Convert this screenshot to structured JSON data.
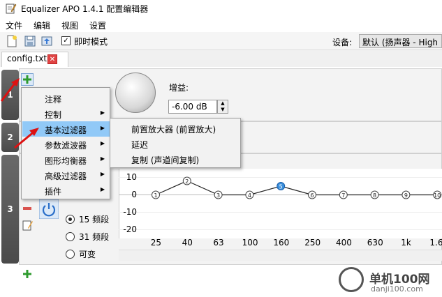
{
  "window": {
    "title": "Equalizer APO 1.4.1 配置编辑器"
  },
  "menubar": {
    "items": [
      "文件",
      "编辑",
      "视图",
      "设置"
    ]
  },
  "toolbar": {
    "instant_mode_label": "即时模式",
    "instant_mode_checked": true,
    "device_label": "设备:",
    "device_value": "默认 (扬声器 - High De"
  },
  "tabs": [
    {
      "label": "config.txt",
      "close_icon": "close-icon"
    }
  ],
  "sections": [
    "1",
    "2",
    "3"
  ],
  "preamp": {
    "gain_label": "增益:",
    "gain_value": "-6.00 dB"
  },
  "context_menu": {
    "items": [
      {
        "label": "注释",
        "has_submenu": false
      },
      {
        "label": "控制",
        "has_submenu": true
      },
      {
        "label": "基本过滤器",
        "has_submenu": true,
        "highlighted": true
      },
      {
        "label": "参数滤波器",
        "has_submenu": true
      },
      {
        "label": "图形均衡器",
        "has_submenu": true
      },
      {
        "label": "高级过滤器",
        "has_submenu": true
      },
      {
        "label": "插件",
        "has_submenu": true
      }
    ],
    "submenu": [
      "前置放大器 (前置放大)",
      "延迟",
      "复制 (声道间复制)"
    ]
  },
  "band_options": [
    {
      "label": "15 频段",
      "selected": true
    },
    {
      "label": "31 频段",
      "selected": false
    },
    {
      "label": "可变",
      "selected": false
    }
  ],
  "chart_data": {
    "type": "line",
    "y_ticks": [
      "10",
      "0",
      "-10",
      "-20"
    ],
    "x": [
      "25",
      "40",
      "63",
      "100",
      "160",
      "250",
      "400",
      "630",
      "1k",
      "1.6"
    ],
    "series": [
      {
        "values": [
          0,
          8,
          0,
          0,
          5,
          0,
          0,
          0,
          0,
          0
        ]
      }
    ],
    "point_labels": [
      "1",
      "2",
      "3",
      "4",
      "5",
      "6",
      "7",
      "8",
      "9",
      "10"
    ],
    "selected_index": 4,
    "ylim": [
      -25,
      15
    ]
  },
  "watermark": {
    "line1": "单机100网",
    "line2": "danji100.com"
  }
}
